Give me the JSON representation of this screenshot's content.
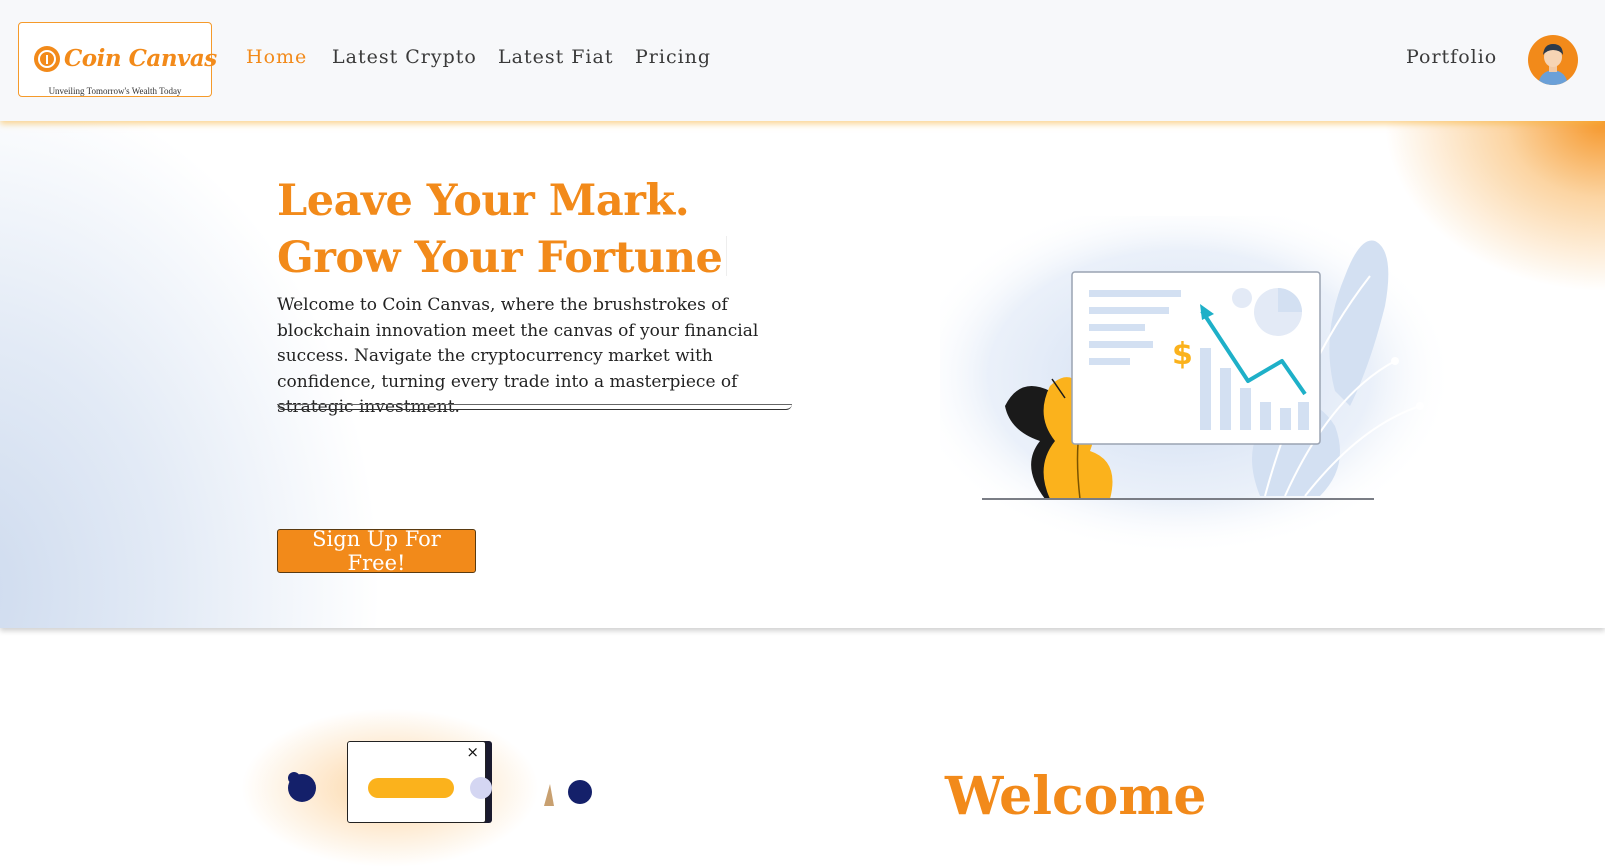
{
  "brand": {
    "name": "Coin Canvas",
    "tagline": "Unveiling Tomorrow's Wealth Today",
    "accent_color": "#f28a1a"
  },
  "nav": {
    "links": [
      {
        "label": "Home",
        "active": true
      },
      {
        "label": "Latest Crypto",
        "active": false
      },
      {
        "label": "Latest Fiat",
        "active": false
      },
      {
        "label": "Pricing",
        "active": false
      }
    ],
    "portfolio_label": "Portfolio",
    "avatar_icon": "user-avatar-icon"
  },
  "hero": {
    "title_line1": "Leave Your Mark.",
    "title_line2": "Grow Your Fortune",
    "description": "Welcome to Coin Canvas, where the brushstrokes of blockchain innovation meet the canvas of your financial success. Navigate the cryptocurrency market with confidence, turning every trade into a masterpiece of strategic investment.",
    "cta_label": "Sign Up For Free!",
    "illustration": {
      "currency_symbol": "$",
      "icon": "growth-chart-illustration"
    }
  },
  "section2": {
    "title_partial": "Welcome",
    "modal_close": "×"
  }
}
